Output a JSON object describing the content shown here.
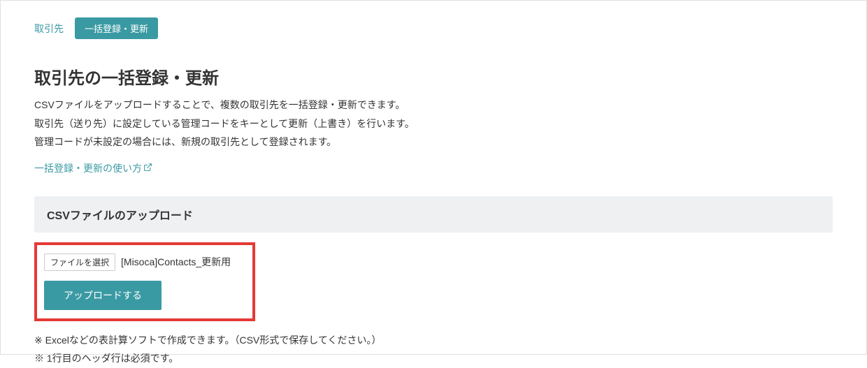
{
  "breadcrumb": {
    "parent": "取引先",
    "current": "一括登録・更新"
  },
  "page": {
    "title": "取引先の一括登録・更新",
    "desc_line1": "CSVファイルをアップロードすることで、複数の取引先を一括登録・更新できます。",
    "desc_line2": "取引先（送り先）に設定している管理コードをキーとして更新（上書き）を行います。",
    "desc_line3": "管理コードが未設定の場合には、新規の取引先として登録されます。",
    "help_link": "一括登録・更新の使い方"
  },
  "upload": {
    "section_title": "CSVファイルのアップロード",
    "file_select_label": "ファイルを選択",
    "filename": "[Misoca]Contacts_更新用",
    "upload_button": "アップロードする"
  },
  "notes": {
    "line1": "※ Excelなどの表計算ソフトで作成できます。（CSV形式で保存してください。）",
    "line2": "※ 1行目のヘッダ行は必須です。"
  }
}
